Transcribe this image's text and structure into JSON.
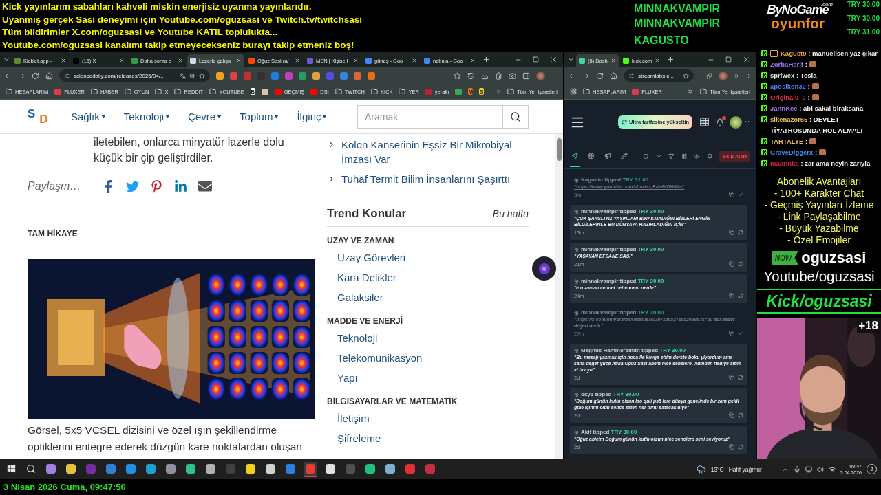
{
  "overlay": {
    "lines": [
      "Kick yayınlarım sabahları kahveli miskin enerjisiz uyanma yayınlarıdır.",
      "Uyanmış gerçek Sasi deneyimi için Youtube.com/oguzsasi ve Twitch.tv/twitchsasi",
      "Tüm bildirimler X.com/oguzsasi ve Youtube KATIL toplulukta...",
      "Youtube.com/oguzsasi kanalımı takip etmeyecekseniz burayı takip etmeniz boş!"
    ],
    "names": [
      "MINNAKVAMPIR",
      "MINNAKVAMPIR",
      "KAGUSTO"
    ]
  },
  "sponsor": {
    "brand": "ByNoGame",
    "domain": ".com",
    "sub": "oyunfor",
    "amounts": [
      "TRY 30.00",
      "TRY 30.00",
      "TRY 31.00"
    ]
  },
  "left_browser": {
    "tabs": [
      {
        "title": "Kicklet.app -",
        "color": "#5a8a3a",
        "selected": false
      },
      {
        "title": "(15) X",
        "color": "#000000",
        "selected": false
      },
      {
        "title": "Daha sonra o",
        "color": "#2ea043",
        "selected": false
      },
      {
        "title": "Lazerle çalışa",
        "color": "#d0d8e0",
        "selected": true
      },
      {
        "title": "Oğuz Sasi (u/",
        "color": "#ff4500",
        "selected": false
      },
      {
        "title": "MSN | Kişisell",
        "color": "#6a5acd",
        "selected": false
      },
      {
        "title": "güneş - Goo",
        "color": "#4285f4",
        "selected": false
      },
      {
        "title": "nebula - Goo",
        "color": "#4285f4",
        "selected": false
      }
    ],
    "address": "sciencedaily.com/releases/2026/04/...",
    "bookmarks": [
      {
        "kind": "folder",
        "label": "HESAPLARIM"
      },
      {
        "kind": "site",
        "label": "FLUXER",
        "color": "#e03a4a"
      },
      {
        "kind": "folder",
        "label": "HABER"
      },
      {
        "kind": "folder",
        "label": "OYUN"
      },
      {
        "kind": "folder",
        "label": "X"
      },
      {
        "kind": "folder",
        "label": "REDDIT"
      },
      {
        "kind": "folder",
        "label": "YOUTUBE"
      },
      {
        "kind": "letter",
        "label": "B",
        "color": "#ffffff"
      },
      {
        "kind": "icon",
        "color": "#e0c0a0"
      },
      {
        "kind": "site",
        "label": "GEÇMİŞ",
        "color": "#ff0000"
      },
      {
        "kind": "site",
        "label": "DSİ",
        "color": "#ff0000"
      },
      {
        "kind": "folder",
        "label": "TWITCH"
      },
      {
        "kind": "folder",
        "label": "KICK"
      },
      {
        "kind": "folder",
        "label": "YER"
      },
      {
        "kind": "site",
        "label": "yeraltı",
        "color": "#c02030"
      },
      {
        "kind": "icon",
        "color": "#34a853"
      },
      {
        "kind": "letter",
        "label": "M",
        "color": "#f07020"
      },
      {
        "kind": "letter",
        "label": "S",
        "color": "#f0d020"
      }
    ],
    "bookmarks_end": "Tüm Yer İşaretleri"
  },
  "site": {
    "logo": [
      "S",
      "D"
    ],
    "nav": [
      "Sağlık",
      "Teknoloji",
      "Çevre",
      "Toplum",
      "İlginç"
    ],
    "search": {
      "placeholder": "Aramak"
    },
    "article": {
      "paragraph": "iletebilen, onlarca minyatür lazerle dolu küçük bir çip geliştirdiler.",
      "share_label": "Paylaşm…",
      "section": "TAM HİKAYE",
      "caption": "Görsel, 5x5 VCSEL dizisini ve özel ışın şekillendirme optiklerini entegre ederek düzgün kare noktalardan oluşan"
    },
    "sidebar": {
      "links": [
        "Kolon Kanserinin Eşsiz Bir Mikrobiyal İmzası Var",
        "Tuhaf Termit Bilim İnsanlarını Şaşırttı"
      ],
      "trend": {
        "title": "Trend Konular",
        "period": "Bu hafta"
      },
      "groups": [
        {
          "title": "UZAY VE ZAMAN",
          "items": [
            "Uzay Görevleri",
            "Kara Delikler",
            "Galaksiler"
          ]
        },
        {
          "title": "MADDE VE ENERJİ",
          "items": [
            "Teknoloji",
            "Telekomünikasyon",
            "Yapı"
          ]
        },
        {
          "title": "BİLGİSAYARLAR VE MATEMATİK",
          "items": [
            "İletişim",
            "Şifreleme"
          ]
        }
      ]
    }
  },
  "right_browser": {
    "tabs": [
      {
        "title": "(8) Dash",
        "color": "#3ed6a0",
        "selected": true
      },
      {
        "title": "kick.com",
        "color": "#53fc18",
        "selected": false
      }
    ],
    "address": "streamlabs.c...",
    "bookmarks": [
      {
        "kind": "folder",
        "label": "HESAPLARIM"
      },
      {
        "kind": "site",
        "label": "FLUXER",
        "color": "#e03a4a"
      }
    ],
    "bookmarks_end": "Tüm Yer İşaretleri"
  },
  "dashboard": {
    "upgrade": "Ultra tarifesine yükseltin",
    "skip": "Skip Alert",
    "tools": [
      {
        "kind": "send",
        "selected": true
      },
      {
        "kind": "gift",
        "selected": false
      },
      {
        "kind": "megaphone",
        "selected": false
      },
      {
        "kind": "pen",
        "selected": false
      }
    ],
    "tips": [
      {
        "name": "Kagusto",
        "verb": "tipped",
        "amount": "TRY 31.00",
        "link": "\"https://www.youtube.com/shorts/_P-bHYDH60w\"",
        "time": "3m",
        "read": true
      },
      {
        "name": "minnakvampir",
        "verb": "tipped",
        "amount": "TRY 30.00",
        "message": "\"ÇOK ŞANSLIYIZ YAYINLARI BIRAKMADIĞIN BİZLERİ ENGİN BİLGİLERİNLE BU DÜNYAYA HAZIRLADIĞIN İÇİN\"",
        "time": "13m",
        "read": false
      },
      {
        "name": "minnakvampir",
        "verb": "tipped",
        "amount": "TRY 30.00",
        "message": "\"YAŞAYAN EFSANE SASİ\"",
        "time": "21m",
        "read": false
      },
      {
        "name": "minnakvampir",
        "verb": "tipped",
        "amount": "TRY 30.00",
        "message": "\"e o zaman cennet cehennem nerde\"",
        "time": "24m",
        "read": false
      },
      {
        "name": "minnakvampir",
        "verb": "tipped",
        "amount": "TRY 30.00",
        "link": "\"https://x.com/onlydramaX/status/2039715652718526588?s=20",
        "message": "abi haber değeri nedir\"",
        "time": "27m",
        "read": true
      },
      {
        "name": "Magnus Hammersmith",
        "verb": "tipped",
        "amount": "TRY 30.00",
        "message": "\"Bu mesajı yazmak için hoca ile kavga ettim derste boku yiyordum ama sana değer yüce Atilla Oğuz Sasi abem nice senelere. Xdmden hediye attım vi lav yu\"",
        "time": "2d",
        "read": false
      },
      {
        "name": "oky1",
        "verb": "tipped",
        "amount": "TRY 30.00",
        "message": "\"Doğum günün kutlu olsun lao guli ps5 lere dünya genelinde bir zam geldi gta6 içinmi oldu sence zaten her türlü satacak diye\"",
        "time": "2d",
        "read": false
      },
      {
        "name": "Akif",
        "verb": "tipped",
        "amount": "TRY 30.00",
        "message": "\"Oğuz abicim Doğum günün kutlu olsun nice senelere seni seviyoruz\"",
        "time": "2d",
        "read": false
      }
    ]
  },
  "chat": [
    {
      "user": "Kagust0",
      "separator": ":",
      "color": "#e8a23a",
      "message": "manuellsen yaz çıkar",
      "badge": true,
      "emote": false
    },
    {
      "user": "ZorbaHerif",
      "separator": ":",
      "color": "#a070f0",
      "badge": false,
      "emote": true
    },
    {
      "user": "spriwex",
      "separator": ":",
      "color": "#d8f0d8",
      "message": "Tesla",
      "badge": false,
      "emote": false
    },
    {
      "user": "aposiken32",
      "separator": ":",
      "color": "#4a7cf0",
      "badge": false,
      "emote": true
    },
    {
      "user": "Original0_0",
      "separator": ":",
      "color": "#e0304a",
      "badge": false,
      "emote": true
    },
    {
      "user": "JannKee",
      "separator": ":",
      "color": "#9a6af0",
      "message": "abi sakal biraksana",
      "badge": false,
      "emote": false
    },
    {
      "user": "sikenazor55",
      "separator": ":",
      "color": "#e8c060",
      "message": "DEVLET TİYATROSUNDA ROL ALMALı",
      "badge": false,
      "emote": false
    },
    {
      "user": "TARTALYE",
      "separator": ":",
      "color": "#e8c060",
      "badge": false,
      "emote": true
    },
    {
      "user": "GraveDiggerx",
      "separator": ":",
      "color": "#3a8af0",
      "badge": false,
      "emote": true
    },
    {
      "user": "maarinka",
      "separator": ":",
      "color": "#d02040",
      "message": "zar ama neyin zarıyla",
      "badge": false,
      "emote": false
    }
  ],
  "perks": {
    "title": "Abonelik Avantajları",
    "items": [
      "- 100+ Karakter Chat",
      "- Geçmiş Yayınları İzleme",
      "- Link Paylaşabilme",
      "- Büyük Yazabilme",
      "- Özel Emojiler"
    ]
  },
  "socials": {
    "now_badge": "NOW",
    "now_name": "oguzsasi",
    "youtube": "Youtube/oguzsasi",
    "kick": "Kick/oguzsasi"
  },
  "webcam": {
    "kind": "picture",
    "badge": "+18"
  },
  "taskbar": {
    "apps": [
      {
        "color": "#a080e0",
        "selected": false
      },
      {
        "color": "#e8c040",
        "selected": false
      },
      {
        "color": "#7030a0",
        "selected": false
      },
      {
        "color": "#3080d0",
        "selected": false
      },
      {
        "color": "#2090e0",
        "selected": false
      },
      {
        "color": "#20a0d0",
        "selected": false
      },
      {
        "color": "#9090a0",
        "selected": false
      },
      {
        "color": "#30c090",
        "selected": false
      },
      {
        "color": "#b0b0b0",
        "selected": false
      },
      {
        "color": "#404040",
        "selected": false
      },
      {
        "color": "#f0d020",
        "selected": false
      },
      {
        "color": "#d0d0d0",
        "selected": false
      },
      {
        "color": "#2a80e0",
        "selected": false
      },
      {
        "color": "#e04030",
        "selected": true
      },
      {
        "color": "#e0e0e0",
        "selected": false
      },
      {
        "color": "#505050",
        "selected": false
      },
      {
        "color": "#20c080",
        "selected": false
      },
      {
        "color": "#80b0d0",
        "selected": false
      },
      {
        "color": "#e03030",
        "selected": false
      },
      {
        "color": "#c03040",
        "selected": false
      }
    ],
    "temperature": "13°C",
    "condition": "Hafif yağmur",
    "time": "09:47",
    "date": "3.04.2026",
    "notifications": "2"
  },
  "datebar": "3 Nisan 2026 Cuma, 09:47:50"
}
